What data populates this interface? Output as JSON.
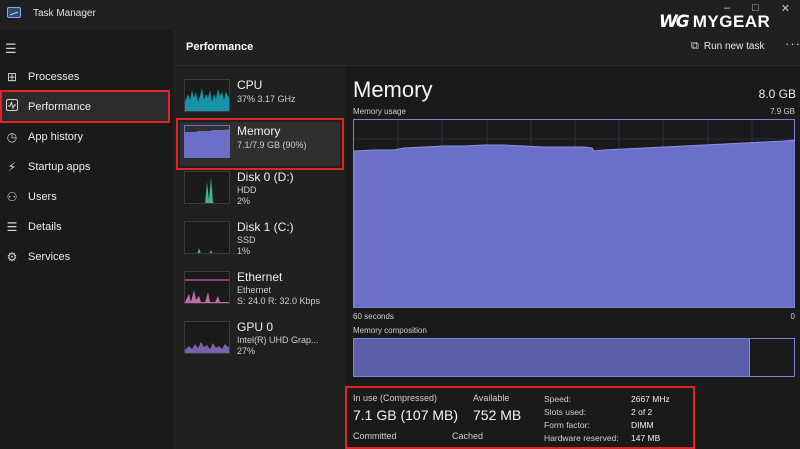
{
  "window": {
    "title": "Task Manager",
    "controls": [
      "–",
      "□",
      "✕"
    ]
  },
  "brand": {
    "mark": "WG",
    "name": "MYGEAR"
  },
  "sidebar": {
    "items": [
      {
        "label": "Processes",
        "icon": "grid-icon"
      },
      {
        "label": "Performance",
        "icon": "performance-icon",
        "active": true
      },
      {
        "label": "App history",
        "icon": "history-icon"
      },
      {
        "label": "Startup apps",
        "icon": "startup-icon"
      },
      {
        "label": "Users",
        "icon": "users-icon"
      },
      {
        "label": "Details",
        "icon": "details-icon"
      },
      {
        "label": "Services",
        "icon": "services-icon"
      }
    ]
  },
  "header": {
    "title": "Performance",
    "run_new_task": "Run new task",
    "more": "···"
  },
  "devices": [
    {
      "name": "CPU",
      "sub1": "37% 3.17 GHz",
      "sub2": "",
      "sub3": "",
      "color": "#17a9c2"
    },
    {
      "name": "Memory",
      "sub1": "7.1/7.9 GB (90%)",
      "sub2": "",
      "sub3": "",
      "color": "#6b6fc8"
    },
    {
      "name": "Disk 0 (D:)",
      "sub1": "HDD",
      "sub2": "2%",
      "sub3": "",
      "color": "#3fb38a"
    },
    {
      "name": "Disk 1 (C:)",
      "sub1": "SSD",
      "sub2": "1%",
      "sub3": "",
      "color": "#3fb38a"
    },
    {
      "name": "Ethernet",
      "sub1": "Ethernet",
      "sub2": "S: 24.0  R: 32.0 Kbps",
      "sub3": "",
      "color": "#e07ac0"
    },
    {
      "name": "GPU 0",
      "sub1": "Intel(R) UHD Grap...",
      "sub2": "27%",
      "sub3": "",
      "color": "#8a6fc8"
    }
  ],
  "detail": {
    "title": "Memory",
    "total": "8.0 GB",
    "usage_label": "Memory usage",
    "usage_max": "7.9 GB",
    "axis_left": "60 seconds",
    "axis_right": "0",
    "composition_label": "Memory composition",
    "composition_in_use_fraction": 0.9,
    "usage_fill_color": "#6b6fc8",
    "usage_line_color": "#8b90e8"
  },
  "stats": {
    "in_use_label": "In use (Compressed)",
    "in_use_value": "7.1 GB (107 MB)",
    "available_label": "Available",
    "available_value": "752 MB",
    "committed_label": "Committed",
    "cached_label": "Cached",
    "speed_label": "Speed:",
    "speed_value": "2667 MHz",
    "slots_label": "Slots used:",
    "slots_value": "2 of 2",
    "form_label": "Form factor:",
    "form_value": "DIMM",
    "reserved_label": "Hardware reserved:",
    "reserved_value": "147 MB"
  }
}
